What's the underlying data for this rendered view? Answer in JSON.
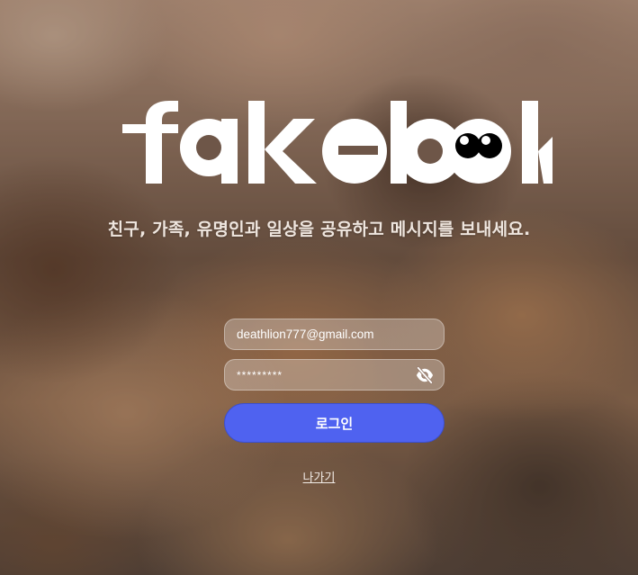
{
  "brand": {
    "logo_text": "fakebook"
  },
  "tagline": "친구, 가족, 유명인과 일상을 공유하고 메시지를 보내세요.",
  "login_form": {
    "email_value": "deathlion777@gmail.com",
    "password_value": "*********",
    "password_toggle_icon": "eye-slash-icon",
    "login_button_label": "로그인",
    "exit_link_label": "나가기"
  },
  "colors": {
    "login_button": "#4f62f0",
    "logo": "#ffffff",
    "logo_eyes": "#000000"
  }
}
